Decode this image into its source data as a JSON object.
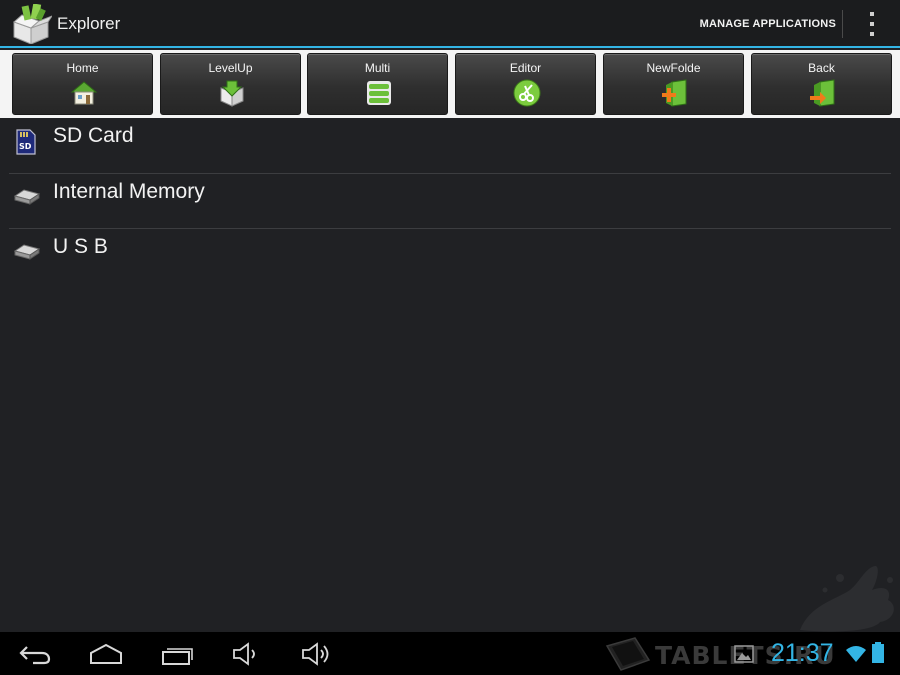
{
  "app": {
    "title": "Explorer",
    "manage_label": "MANAGE APPLICATIONS",
    "overflow_icon": "overflow-menu-icon",
    "accent": "#33b5e5"
  },
  "toolbar": {
    "buttons": [
      {
        "label": "Home",
        "icon": "home-icon"
      },
      {
        "label": "LevelUp",
        "icon": "level-up-icon"
      },
      {
        "label": "Multi",
        "icon": "multi-select-icon"
      },
      {
        "label": "Editor",
        "icon": "editor-icon"
      },
      {
        "label": "NewFolde",
        "icon": "new-folder-icon"
      },
      {
        "label": "Back",
        "icon": "back-icon"
      }
    ]
  },
  "storage": {
    "items": [
      {
        "name": "SD Card",
        "icon": "sd-card-icon"
      },
      {
        "name": "Internal Memory",
        "icon": "drive-icon"
      },
      {
        "name": "U S B",
        "icon": "drive-icon"
      }
    ]
  },
  "system_bar": {
    "watermark": "TABLETS.RU",
    "time": "21:37",
    "icons": [
      "back-icon",
      "home-icon",
      "recent-apps-icon",
      "volume-down-icon",
      "volume-up-icon",
      "screenshot-icon",
      "wifi-icon",
      "battery-icon"
    ]
  }
}
